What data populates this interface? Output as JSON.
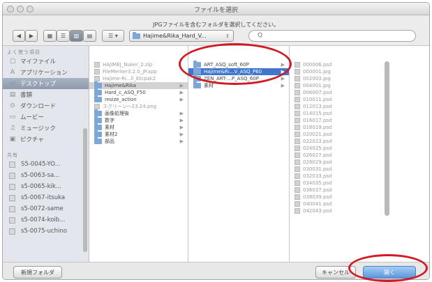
{
  "window": {
    "title": "ファイルを選択"
  },
  "message": "JPGファイルを含むフォルダを選択してください。",
  "toolbar": {
    "back": "◀",
    "forward": "▶",
    "view_icon": "▦",
    "view_list": "☰",
    "view_columns": "▥",
    "view_cover": "▤",
    "arrange": "☰ ▾",
    "path_value": "Hajime&Rika_Hard_V...",
    "search_placeholder": "Q"
  },
  "sidebar": {
    "header_favorites": "よく使う項目",
    "favorites": [
      {
        "icon": "▢",
        "label": "マイファイル"
      },
      {
        "icon": "A",
        "label": "アプリケーション"
      },
      {
        "icon": "▭",
        "label": "デスクトップ",
        "selected": true
      },
      {
        "icon": "▤",
        "label": "書類"
      },
      {
        "icon": "⊙",
        "label": "ダウンロード"
      },
      {
        "icon": "▭",
        "label": "ムービー"
      },
      {
        "icon": "♫",
        "label": "ミュージック"
      },
      {
        "icon": "▣",
        "label": "ピクチャ"
      }
    ],
    "header_shared": "共有",
    "shared": [
      {
        "label": "S5-0045-YO..."
      },
      {
        "label": "s5-0063-sa..."
      },
      {
        "label": "s5-0065-kik..."
      },
      {
        "label": "s5-0067-itsuka"
      },
      {
        "label": "s5-0072-same"
      },
      {
        "label": "s5-0074-koib..."
      },
      {
        "label": "s5-0075-uchino"
      }
    ]
  },
  "column1": [
    {
      "label": "HAJIMEǀ_Nuker_2.zip",
      "dim": true
    },
    {
      "label": "FileMerker3.2.0_JP.app",
      "dim": true
    },
    {
      "label": "Hajime-Ri...ll_Etcpak2",
      "dim": true
    },
    {
      "label": "Hajime&Rika",
      "folder": true,
      "arrow": true,
      "highlight": true
    },
    {
      "label": "Hard_c_ASQ_F50",
      "folder": true,
      "arrow": true
    },
    {
      "label": "resize_action",
      "folder": true,
      "arrow": true
    },
    {
      "label": "スクリーン〜23.24.png",
      "dim": true
    },
    {
      "label": "画像処理後",
      "folder": true,
      "arrow": true
    },
    {
      "label": "数字",
      "folder": true,
      "arrow": true
    },
    {
      "label": "素材",
      "folder": true,
      "arrow": true
    },
    {
      "label": "素材2",
      "folder": true,
      "arrow": true
    },
    {
      "label": "部品",
      "folder": true,
      "arrow": true
    }
  ],
  "column2": [
    {
      "label": "ART_ASQ_soft_60P",
      "arrow": true
    },
    {
      "label": "Hajime&Ri...V_ASQ_P60",
      "arrow": true,
      "selected": true
    },
    {
      "label": "ZEN_ART-...P_ASQ_60P",
      "arrow": true
    },
    {
      "label": "素材",
      "arrow": true
    }
  ],
  "column3": [
    "000006.psd",
    "000001.jpg",
    "002003.jpg",
    "004001.jpg",
    "006007.psd",
    "010011.psd",
    "012013.psd",
    "014015.psd",
    "016017.psd",
    "018019.psd",
    "020021.psd",
    "022023.psd",
    "024025.psd",
    "026027.psd",
    "028029.psd",
    "030031.psd",
    "032033.psd",
    "034035.psd",
    "036037.psd",
    "038039.psd",
    "040041.psd",
    "042043.psd"
  ],
  "buttons": {
    "new_folder": "新規フォルダ",
    "cancel": "キャンセル",
    "open": "開く"
  },
  "colors": {
    "selection": "#3f77cf",
    "sidebar_selection": "#8e9aad",
    "annotation": "#d21a24",
    "primary_button": "#5b96db"
  }
}
